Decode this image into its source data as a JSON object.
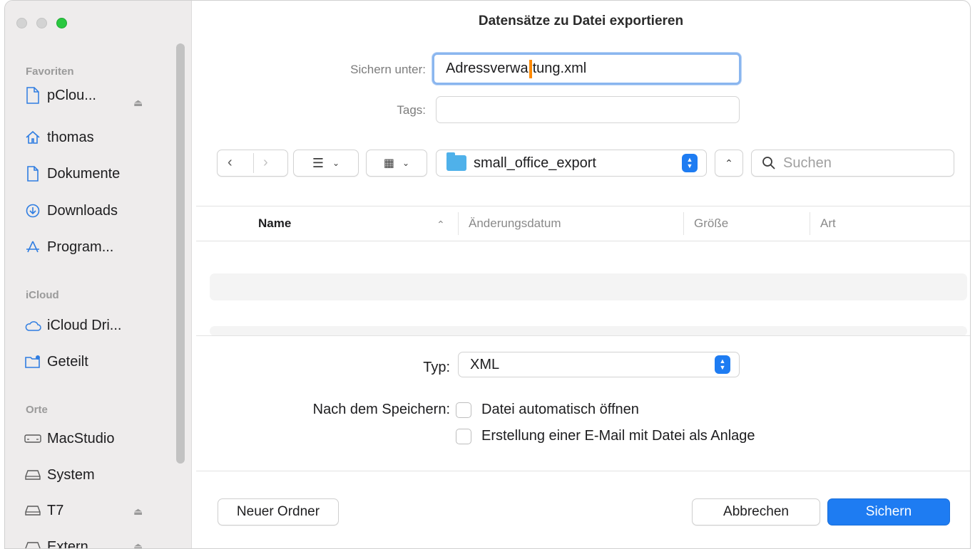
{
  "window": {
    "title": "Datensätze zu Datei exportieren"
  },
  "sidebar": {
    "sections": [
      {
        "label": "Favoriten"
      },
      {
        "label": "iCloud"
      },
      {
        "label": "Orte"
      }
    ],
    "favorites": [
      {
        "label": "pClou...",
        "icon": "document-icon"
      },
      {
        "label": "thomas",
        "icon": "home-icon"
      },
      {
        "label": "Dokumente",
        "icon": "document-icon"
      },
      {
        "label": "Downloads",
        "icon": "download-icon"
      },
      {
        "label": "Program...",
        "icon": "apps-icon"
      }
    ],
    "icloud": [
      {
        "label": "iCloud Dri...",
        "icon": "cloud-icon"
      },
      {
        "label": "Geteilt",
        "icon": "shared-folder-icon"
      }
    ],
    "places": [
      {
        "label": "MacStudio",
        "icon": "computer-icon"
      },
      {
        "label": "System",
        "icon": "drive-icon"
      },
      {
        "label": "T7",
        "icon": "drive-icon"
      },
      {
        "label": "Extern...",
        "icon": "drive-icon"
      }
    ]
  },
  "form": {
    "save_as_label": "Sichern unter:",
    "filename_before_caret": "Adressverwa",
    "filename_after_caret": "tung.xml",
    "tags_label": "Tags:",
    "tags_value": ""
  },
  "toolbar": {
    "location": "small_office_export",
    "search_placeholder": "Suchen"
  },
  "list": {
    "columns": [
      "Name",
      "Änderungsdatum",
      "Größe",
      "Art"
    ]
  },
  "options": {
    "type_label": "Typ:",
    "type_value": "XML",
    "after_save_label": "Nach dem Speichern:",
    "checkbox_open": "Datei automatisch öffnen",
    "checkbox_mail": "Erstellung einer E-Mail mit Datei als Anlage"
  },
  "buttons": {
    "new_folder": "Neuer Ordner",
    "cancel": "Abbrechen",
    "save": "Sichern"
  },
  "colors": {
    "accent": "#1e7cf2",
    "caret": "#ff8a00",
    "folder": "#4fb1ea"
  }
}
